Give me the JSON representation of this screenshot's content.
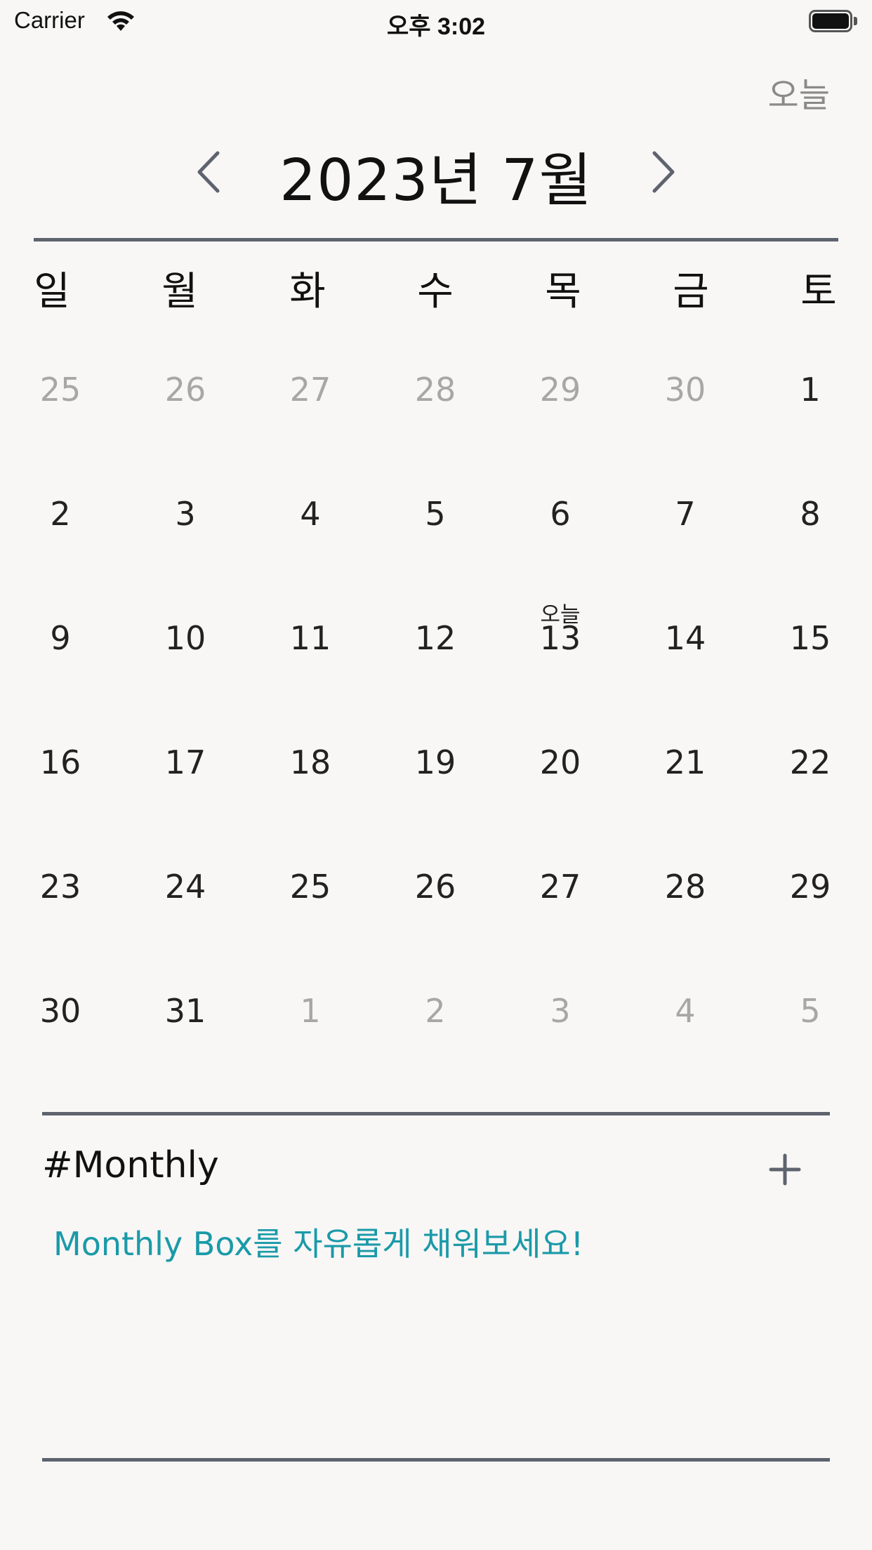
{
  "status_bar": {
    "carrier": "Carrier",
    "time": "오후 3:02"
  },
  "header": {
    "today_button": "오늘",
    "month_title": "2023년 7월",
    "prev_icon": "chevron-left-icon",
    "next_icon": "chevron-right-icon"
  },
  "weekdays": [
    "일",
    "월",
    "화",
    "수",
    "목",
    "금",
    "토"
  ],
  "weeks": [
    [
      {
        "d": "25",
        "muted": true
      },
      {
        "d": "26",
        "muted": true
      },
      {
        "d": "27",
        "muted": true
      },
      {
        "d": "28",
        "muted": true
      },
      {
        "d": "29",
        "muted": true
      },
      {
        "d": "30",
        "muted": true
      },
      {
        "d": "1",
        "muted": false
      }
    ],
    [
      {
        "d": "2",
        "muted": false
      },
      {
        "d": "3",
        "muted": false
      },
      {
        "d": "4",
        "muted": false
      },
      {
        "d": "5",
        "muted": false
      },
      {
        "d": "6",
        "muted": false
      },
      {
        "d": "7",
        "muted": false
      },
      {
        "d": "8",
        "muted": false
      }
    ],
    [
      {
        "d": "9",
        "muted": false
      },
      {
        "d": "10",
        "muted": false
      },
      {
        "d": "11",
        "muted": false
      },
      {
        "d": "12",
        "muted": false
      },
      {
        "d": "13",
        "muted": false,
        "label": "오늘"
      },
      {
        "d": "14",
        "muted": false
      },
      {
        "d": "15",
        "muted": false
      }
    ],
    [
      {
        "d": "16",
        "muted": false
      },
      {
        "d": "17",
        "muted": false
      },
      {
        "d": "18",
        "muted": false
      },
      {
        "d": "19",
        "muted": false
      },
      {
        "d": "20",
        "muted": false
      },
      {
        "d": "21",
        "muted": false
      },
      {
        "d": "22",
        "muted": false
      }
    ],
    [
      {
        "d": "23",
        "muted": false
      },
      {
        "d": "24",
        "muted": false
      },
      {
        "d": "25",
        "muted": false
      },
      {
        "d": "26",
        "muted": false
      },
      {
        "d": "27",
        "muted": false
      },
      {
        "d": "28",
        "muted": false
      },
      {
        "d": "29",
        "muted": false
      }
    ],
    [
      {
        "d": "30",
        "muted": false
      },
      {
        "d": "31",
        "muted": false
      },
      {
        "d": "1",
        "muted": true
      },
      {
        "d": "2",
        "muted": true
      },
      {
        "d": "3",
        "muted": true
      },
      {
        "d": "4",
        "muted": true
      },
      {
        "d": "5",
        "muted": true
      }
    ]
  ],
  "monthly": {
    "title": "#Monthly",
    "add_icon": "plus-icon",
    "placeholder": "Monthly Box를 자유롭게 채워보세요!"
  },
  "colors": {
    "background": "#f8f7f6",
    "divider": "#5e636e",
    "muted_text": "#a7a7a7",
    "accent": "#1a9aa8"
  }
}
